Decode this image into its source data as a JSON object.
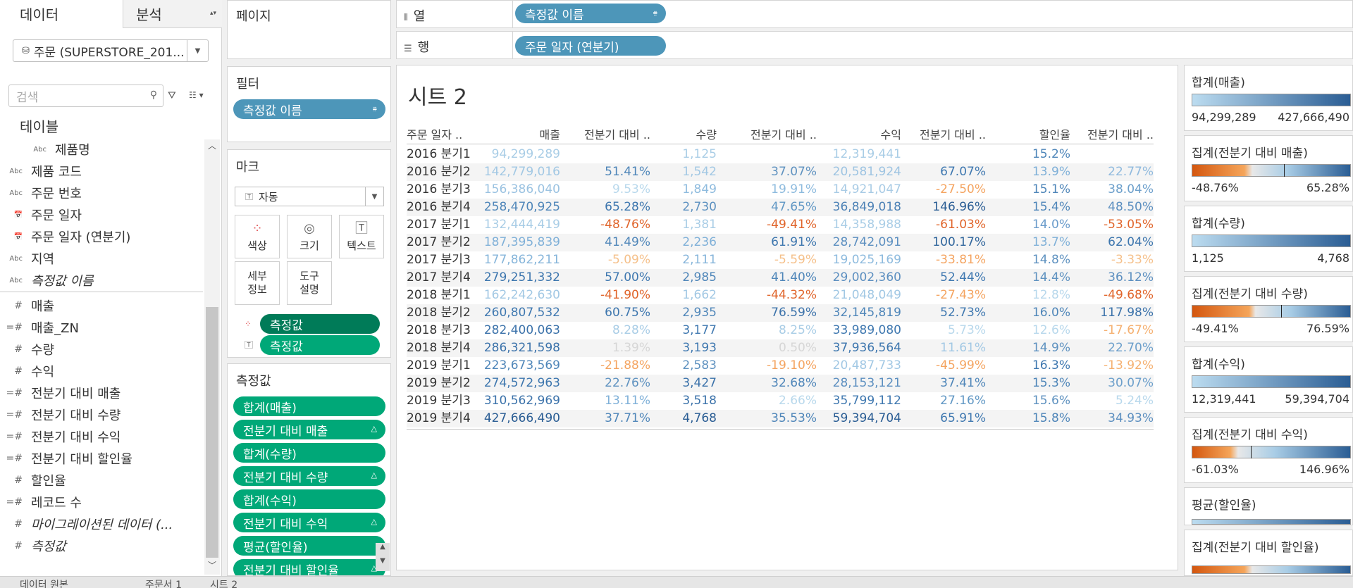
{
  "left_pane": {
    "tab_data": "데이터",
    "tab_analysis": "분석",
    "datasource": "주문 (SUPERSTORE_201...",
    "search_placeholder": "검색",
    "table_heading": "테이블",
    "fields": [
      {
        "type": "Abc",
        "name": "제품명",
        "dim": true
      },
      {
        "type": "Abc",
        "name": "제품 코드"
      },
      {
        "type": "Abc",
        "name": "주문 번호"
      },
      {
        "type": "📅",
        "name": "주문 일자"
      },
      {
        "type": "📅",
        "name": "주문 일자 (연분기)"
      },
      {
        "type": "Abc",
        "name": "지역"
      },
      {
        "type": "Abc",
        "name": "측정값 이름",
        "italic": true
      }
    ],
    "measures": [
      {
        "type": "#",
        "name": "매출"
      },
      {
        "type": "=#",
        "name": "매출_ZN"
      },
      {
        "type": "#",
        "name": "수량"
      },
      {
        "type": "#",
        "name": "수익"
      },
      {
        "type": "=#",
        "name": "전분기 대비 매출"
      },
      {
        "type": "=#",
        "name": "전분기 대비 수량"
      },
      {
        "type": "=#",
        "name": "전분기 대비 수익"
      },
      {
        "type": "=#",
        "name": "전분기 대비 할인율"
      },
      {
        "type": "#",
        "name": "할인율"
      },
      {
        "type": "=#",
        "name": "레코드 수"
      },
      {
        "type": "#",
        "name": "마이그레이션된 데이터 (...",
        "italic": true
      },
      {
        "type": "#",
        "name": "측정값",
        "italic": true
      }
    ]
  },
  "shelves": {
    "pages_title": "페이지",
    "filters_title": "필터",
    "filter_pill": "측정값 이름",
    "marks_title": "마크",
    "mark_type": "자동",
    "mark_buttons": {
      "color": "색상",
      "size": "크기",
      "text": "텍스트",
      "detail_1": "세부",
      "detail_2": "정보",
      "tooltip_1": "도구",
      "tooltip_2": "설명"
    },
    "mark_pill_1": "측정값",
    "mark_pill_2": "측정값",
    "measure_values_title": "측정값",
    "measure_pills": [
      "합계(매출)",
      "전분기 대비 매출",
      "합계(수량)",
      "전분기 대비 수량",
      "합계(수익)",
      "전분기 대비 수익",
      "평균(할인율)",
      "전분기 대비 할인율"
    ],
    "columns_label": "열",
    "columns_pill": "측정값 이름",
    "rows_label": "행",
    "rows_pill": "주문 일자 (연분기)"
  },
  "sheet": {
    "title": "시트 2",
    "headers": [
      "주문 일자 ..",
      "매출",
      "전분기 대비 ..",
      "수량",
      "전분기 대비 ..",
      "수익",
      "전분기 대비 ..",
      "할인율",
      "전분기 대비 .."
    ],
    "rows": [
      [
        "2016 분기1",
        "94,299,289",
        "",
        "1,125",
        "",
        "12,319,441",
        "",
        "15.2%",
        ""
      ],
      [
        "2016 분기2",
        "142,779,016",
        "51.41%",
        "1,542",
        "37.07%",
        "20,581,924",
        "67.07%",
        "13.9%",
        "22.77%"
      ],
      [
        "2016 분기3",
        "156,386,040",
        "9.53%",
        "1,849",
        "19.91%",
        "14,921,047",
        "-27.50%",
        "15.1%",
        "38.04%"
      ],
      [
        "2016 분기4",
        "258,470,925",
        "65.28%",
        "2,730",
        "47.65%",
        "36,849,018",
        "146.96%",
        "15.4%",
        "48.50%"
      ],
      [
        "2017 분기1",
        "132,444,419",
        "-48.76%",
        "1,381",
        "-49.41%",
        "14,358,988",
        "-61.03%",
        "14.0%",
        "-53.05%"
      ],
      [
        "2017 분기2",
        "187,395,839",
        "41.49%",
        "2,236",
        "61.91%",
        "28,742,091",
        "100.17%",
        "13.7%",
        "62.04%"
      ],
      [
        "2017 분기3",
        "177,862,211",
        "-5.09%",
        "2,111",
        "-5.59%",
        "19,025,169",
        "-33.81%",
        "14.8%",
        "-3.33%"
      ],
      [
        "2017 분기4",
        "279,251,332",
        "57.00%",
        "2,985",
        "41.40%",
        "29,002,360",
        "52.44%",
        "14.4%",
        "36.12%"
      ],
      [
        "2018 분기1",
        "162,242,630",
        "-41.90%",
        "1,662",
        "-44.32%",
        "21,048,049",
        "-27.43%",
        "12.8%",
        "-49.68%"
      ],
      [
        "2018 분기2",
        "260,807,532",
        "60.75%",
        "2,935",
        "76.59%",
        "32,145,819",
        "52.73%",
        "16.0%",
        "117.98%"
      ],
      [
        "2018 분기3",
        "282,400,063",
        "8.28%",
        "3,177",
        "8.25%",
        "33,989,080",
        "5.73%",
        "12.6%",
        "-17.67%"
      ],
      [
        "2018 분기4",
        "286,321,598",
        "1.39%",
        "3,193",
        "0.50%",
        "37,936,564",
        "11.61%",
        "14.9%",
        "22.70%"
      ],
      [
        "2019 분기1",
        "223,673,569",
        "-21.88%",
        "2,583",
        "-19.10%",
        "20,487,733",
        "-45.99%",
        "16.3%",
        "-13.92%"
      ],
      [
        "2019 분기2",
        "274,572,963",
        "22.76%",
        "3,427",
        "32.68%",
        "28,153,121",
        "37.41%",
        "15.3%",
        "30.07%"
      ],
      [
        "2019 분기3",
        "310,562,969",
        "13.11%",
        "3,518",
        "2.66%",
        "35,799,112",
        "27.16%",
        "15.6%",
        "5.24%"
      ],
      [
        "2019 분기4",
        "427,666,490",
        "37.71%",
        "4,768",
        "35.53%",
        "59,394,704",
        "65.91%",
        "15.8%",
        "34.93%"
      ]
    ],
    "row_colors": [
      [
        "#333333",
        "#a9cde6",
        "#333333",
        "#a9cde6",
        "#333333",
        "#a9cde6",
        "#333333",
        "#4f86b9",
        "#333333"
      ],
      [
        "#333333",
        "#a2c8e4",
        "#4f86b9",
        "#a2c8e4",
        "#5f92c0",
        "#9ec4e2",
        "#3f78b0",
        "#7fb0d8",
        "#90bade"
      ],
      [
        "#333333",
        "#9ac2e1",
        "#b8d8ec",
        "#8ebbde",
        "#8ebbde",
        "#a8cbe5",
        "#f4a460",
        "#4f86b9",
        "#6c9fcb"
      ],
      [
        "#333333",
        "#4f86b9",
        "#3d76ae",
        "#5d91c0",
        "#6097c4",
        "#4d82b6",
        "#2a5d94",
        "#4f86b9",
        "#5c8fc0"
      ],
      [
        "#333333",
        "#a9cde6",
        "#e0642a",
        "#a9cde6",
        "#e0642a",
        "#a9cde6",
        "#e0642a",
        "#6b9ccb",
        "#e0642a"
      ],
      [
        "#333333",
        "#7fb0d8",
        "#4f86b9",
        "#7fb0d8",
        "#3d76ae",
        "#5c8fc0",
        "#2f659c",
        "#7fb0d8",
        "#3d76ae"
      ],
      [
        "#333333",
        "#86b5da",
        "#f5c08a",
        "#86b5da",
        "#f5c08a",
        "#8ebbde",
        "#f4a460",
        "#5f92c0",
        "#f5c08a"
      ],
      [
        "#333333",
        "#3d76ae",
        "#3f78b0",
        "#4f86b9",
        "#4f86b9",
        "#5c8fc0",
        "#3f78b0",
        "#5f92c0",
        "#5c8fc0"
      ],
      [
        "#333333",
        "#a2c8e4",
        "#e0642a",
        "#a2c8e4",
        "#e0642a",
        "#a2c8e4",
        "#f4a460",
        "#b8d8ec",
        "#e0642a"
      ],
      [
        "#333333",
        "#3f78b0",
        "#3d76ae",
        "#4f86b9",
        "#3b72aa",
        "#4f86b9",
        "#3f78b0",
        "#4f86b9",
        "#3b72aa"
      ],
      [
        "#333333",
        "#3b72aa",
        "#a9cde6",
        "#3f78b0",
        "#a9cde6",
        "#3f78b0",
        "#b8d8ec",
        "#b8d8ec",
        "#f5b070"
      ],
      [
        "#333333",
        "#3b72aa",
        "#d6d6d6",
        "#3f78b0",
        "#d6d6d6",
        "#3d76ae",
        "#a2c8e4",
        "#5f92c0",
        "#6c9fcb"
      ],
      [
        "#333333",
        "#4f86b9",
        "#f4a460",
        "#5f92c0",
        "#f4a460",
        "#a2c8e4",
        "#f4a460",
        "#3f78b0",
        "#f5b070"
      ],
      [
        "#333333",
        "#3d76ae",
        "#5f92c0",
        "#3b72aa",
        "#4f86b9",
        "#5c8fc0",
        "#4f86b9",
        "#4f86b9",
        "#6c9fcb"
      ],
      [
        "#333333",
        "#3b72aa",
        "#7fb0d8",
        "#3b72aa",
        "#b8d8ec",
        "#3f78b0",
        "#6097c4",
        "#5f92c0",
        "#b8d8ec"
      ],
      [
        "#333333",
        "#2a5d94",
        "#4f86b9",
        "#2a5d94",
        "#4f86b9",
        "#2a5d94",
        "#3f78b0",
        "#4f86b9",
        "#5c8fc0"
      ]
    ]
  },
  "legends": [
    {
      "title": "합계(매출)",
      "min": "94,299,289",
      "max": "427,666,490",
      "kind": "seq"
    },
    {
      "title": "집계(전분기 대비 매출)",
      "min": "-48.76%",
      "max": "65.28%",
      "kind": "div"
    },
    {
      "title": "합계(수량)",
      "min": "1,125",
      "max": "4,768",
      "kind": "seq"
    },
    {
      "title": "집계(전분기 대비 수량)",
      "min": "-49.41%",
      "max": "76.59%",
      "kind": "div"
    },
    {
      "title": "합계(수익)",
      "min": "12,319,441",
      "max": "59,394,704",
      "kind": "seq"
    },
    {
      "title": "집계(전분기 대비 수익)",
      "min": "-61.03%",
      "max": "146.96%",
      "kind": "div"
    },
    {
      "title": "평균(할인율)",
      "min": "",
      "max": "",
      "kind": "seq"
    },
    {
      "title": "집계(전분기 대비 할인율)",
      "min": "",
      "max": "",
      "kind": "div"
    }
  ],
  "bottom_tabs": [
    "데이터 원본",
    "주문서 1",
    "시트 2"
  ]
}
